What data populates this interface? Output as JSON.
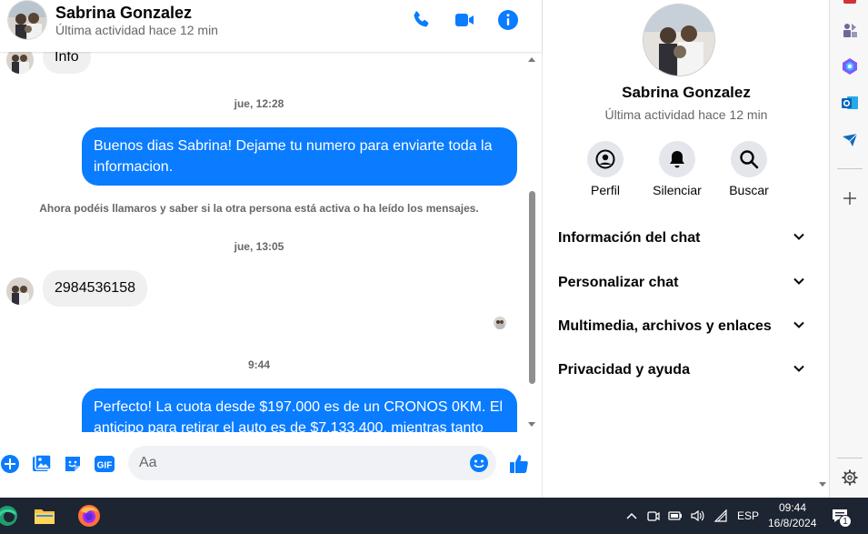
{
  "contact": {
    "name": "Sabrina Gonzalez",
    "status": "Última actividad hace 12 min"
  },
  "header_icons": [
    "phone-icon",
    "video-call-icon",
    "info-icon"
  ],
  "messages": {
    "partial_top": "Info",
    "ts1": "jue, 12:28",
    "out1": "Buenos dias Sabrina! Dejame tu numero para enviarte toda la informacion.",
    "system": "Ahora podéis llamaros y saber si la otra persona está activa o ha leído los mensajes.",
    "ts2": "jue, 13:05",
    "in1": "2984536158",
    "ts3": "9:44",
    "out2": "Perfecto! La cuota desde $197.000 es de un CRONOS 0KM. El anticipo para retirar el auto es de $7.133.400, mientras tanto"
  },
  "composer": {
    "placeholder": "Aa",
    "icons": [
      "plus-icon",
      "image-icon",
      "sticker-icon",
      "gif-icon",
      "emoji-icon",
      "thumbs-up-icon"
    ],
    "gif_label": "GIF"
  },
  "details": {
    "name": "Sabrina Gonzalez",
    "status": "Última actividad hace 12 min",
    "actions": [
      {
        "label": "Perfil",
        "icon": "profile-icon"
      },
      {
        "label": "Silenciar",
        "icon": "bell-icon"
      },
      {
        "label": "Buscar",
        "icon": "search-icon"
      }
    ],
    "sections": [
      "Información del chat",
      "Personalizar chat",
      "Multimedia, archivos y enlaces",
      "Privacidad y ayuda"
    ]
  },
  "taskbar": {
    "lang": "ESP",
    "time": "09:44",
    "date": "16/8/2024",
    "notification_count": "1"
  },
  "colors": {
    "accent": "#0a7cff",
    "header_icon": "#0a7cff",
    "incoming_bubble": "#f0f0f0",
    "taskbar": "#1d2432"
  }
}
